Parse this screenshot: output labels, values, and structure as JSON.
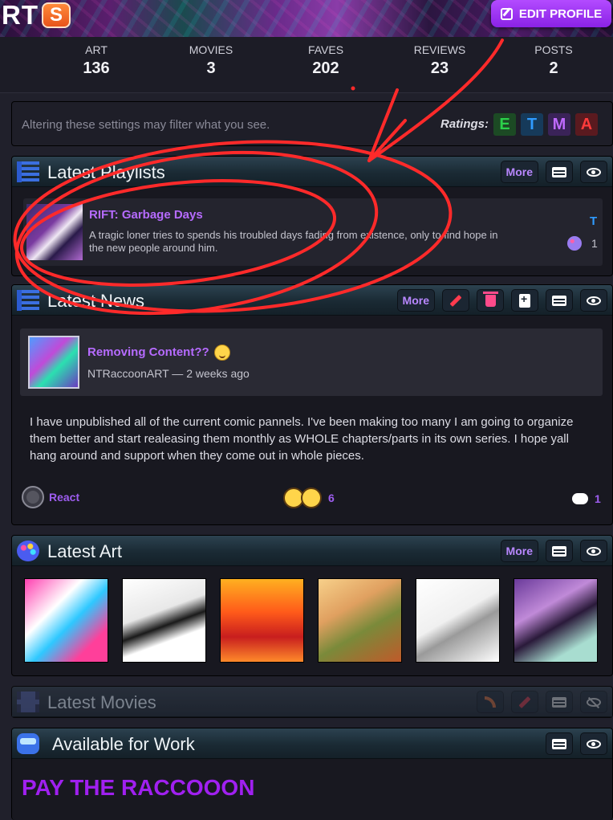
{
  "header": {
    "name_fragment": "RT",
    "badge": "S",
    "edit_profile_label": "EDIT PROFILE"
  },
  "stats": [
    {
      "label": "ART",
      "value": "136"
    },
    {
      "label": "MOVIES",
      "value": "3"
    },
    {
      "label": "FAVES",
      "value": "202"
    },
    {
      "label": "REVIEWS",
      "value": "23"
    },
    {
      "label": "POSTS",
      "value": "2"
    }
  ],
  "filter": {
    "notice": "Altering these settings may filter what you see.",
    "ratings_label": "Ratings:",
    "ratings": [
      {
        "letter": "E",
        "color": "#2bd14a",
        "bg": "#1c4a24"
      },
      {
        "letter": "T",
        "color": "#2f9bff",
        "bg": "#163a5a"
      },
      {
        "letter": "M",
        "color": "#c06aff",
        "bg": "#3a2358"
      },
      {
        "letter": "A",
        "color": "#ff3b3b",
        "bg": "#5a1a1f"
      }
    ]
  },
  "playlists": {
    "title": "Latest Playlists",
    "more_label": "More",
    "item": {
      "title": "RIFT: Garbage Days",
      "description": "A tragic loner tries to spends his troubled days fading from existence, only to find hope in the new people around him.",
      "rating": "T",
      "count": "1"
    }
  },
  "news": {
    "title": "Latest News",
    "more_label": "More",
    "post_title": "Removing Content??",
    "meta": "NTRaccoonART — 2 weeks ago",
    "body": "I have unpublished all of the current comic pannels. I've been making too many I am going to organize them better and start realeasing them monthly as WHOLE chapters/parts in its own series. I hope yall hang around and support when they come out in whole pieces.",
    "react_label": "React",
    "reaction_count": "6",
    "comment_count": "1"
  },
  "art": {
    "title": "Latest Art",
    "more_label": "More",
    "thumbnails": [
      {
        "bg": "linear-gradient(135deg,#ff3fb0,#ffffff 35%,#2ec8ff 55%,#ff3f9a 80%)"
      },
      {
        "bg": "linear-gradient(160deg,#ffffff,#e8e8e8 40%,#1a1a1a 55%,#ffffff 70%)"
      },
      {
        "bg": "linear-gradient(180deg,#ffb020,#ff5a1a 40%,#c81e1e 70%,#ff8a2a)"
      },
      {
        "bg": "linear-gradient(150deg,#f7d08a,#e0a060 35%,#7a8a3a 60%,#c05a2a)"
      },
      {
        "bg": "linear-gradient(150deg,#ffffff,#f0f0f0 45%,#9a9a9a 60%,#ffffff)"
      },
      {
        "bg": "linear-gradient(150deg,#6a3a9a,#c08ad8 35%,#2a1a3a 55%,#a8ddd0 80%)"
      }
    ]
  },
  "movies": {
    "title": "Latest Movies"
  },
  "work": {
    "title": "Available for Work",
    "text": "PAY THE RACCOOON"
  }
}
